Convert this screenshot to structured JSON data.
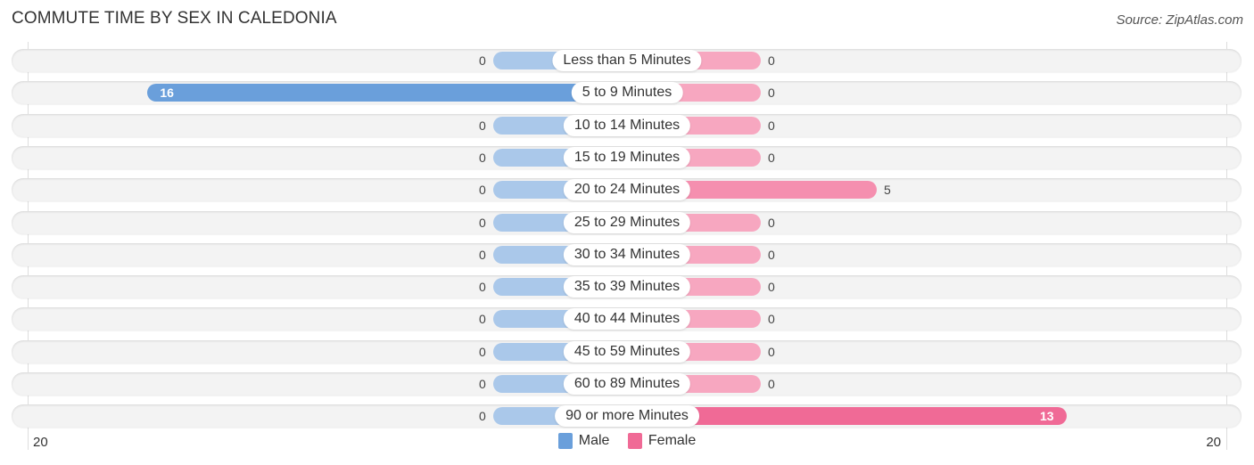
{
  "title": "COMMUTE TIME BY SEX IN CALEDONIA",
  "source": "Source: ZipAtlas.com",
  "colors": {
    "male_light": "#aac8ea",
    "male": "#6a9fdb",
    "female_light": "#f7a7c0",
    "female_mid": "#f58faf",
    "female": "#f06a96"
  },
  "chart_data": {
    "type": "bar",
    "orientation": "horizontal-diverging",
    "title": "COMMUTE TIME BY SEX IN CALEDONIA",
    "categories": [
      "Less than 5 Minutes",
      "5 to 9 Minutes",
      "10 to 14 Minutes",
      "15 to 19 Minutes",
      "20 to 24 Minutes",
      "25 to 29 Minutes",
      "30 to 34 Minutes",
      "35 to 39 Minutes",
      "40 to 44 Minutes",
      "45 to 59 Minutes",
      "60 to 89 Minutes",
      "90 or more Minutes"
    ],
    "series": [
      {
        "name": "Male",
        "values": [
          0,
          16,
          0,
          0,
          0,
          0,
          0,
          0,
          0,
          0,
          0,
          0
        ]
      },
      {
        "name": "Female",
        "values": [
          0,
          0,
          0,
          0,
          5,
          0,
          0,
          0,
          0,
          0,
          0,
          13
        ]
      }
    ],
    "axis": {
      "left_tick": "20",
      "right_tick": "20",
      "range": [
        -20,
        20
      ]
    },
    "legend": {
      "position": "bottom-center",
      "entries": [
        "Male",
        "Female"
      ]
    }
  }
}
